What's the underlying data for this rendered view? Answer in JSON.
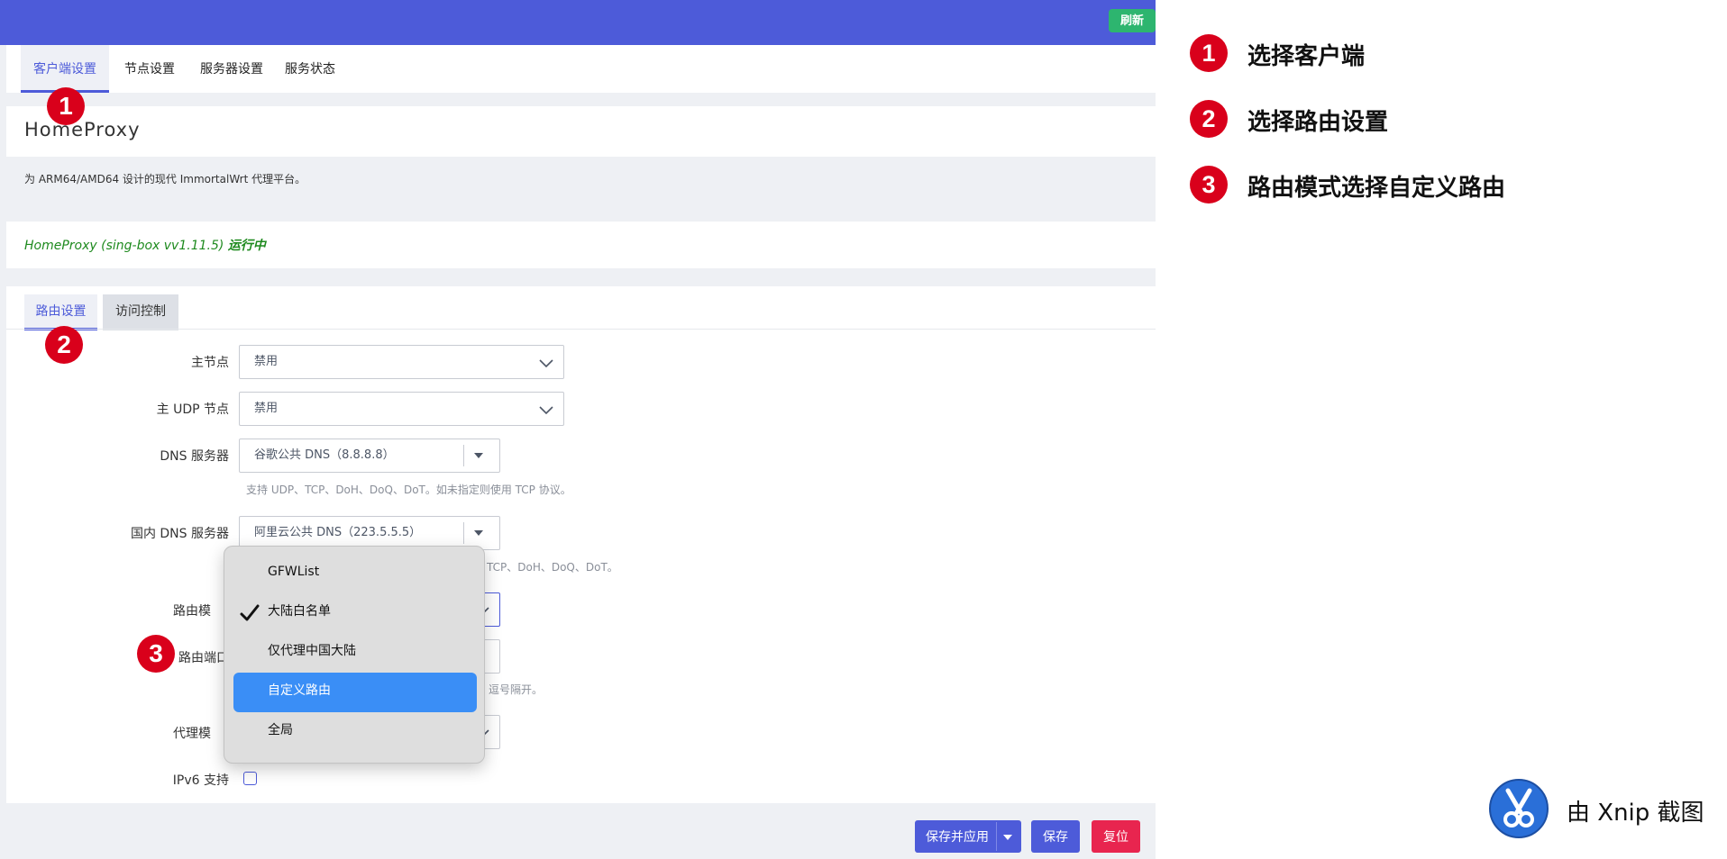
{
  "header": {
    "refresh_label": "刷新"
  },
  "main_tabs": [
    {
      "label": "客户端设置",
      "active": true
    },
    {
      "label": "节点设置",
      "active": false
    },
    {
      "label": "服务器设置",
      "active": false
    },
    {
      "label": "服务状态",
      "active": false
    }
  ],
  "page": {
    "title": "HomeProxy",
    "description": "为 ARM64/AMD64 设计的现代 ImmortalWrt 代理平台。",
    "status_prefix": "HomeProxy (sing-box vv1.11.5) ",
    "status_state": "运行中"
  },
  "sub_tabs": [
    {
      "label": "路由设置",
      "active": true
    },
    {
      "label": "访问控制",
      "active": false
    }
  ],
  "fields": {
    "main_node": {
      "label": "主节点",
      "value": "禁用"
    },
    "main_udp_node": {
      "label": "主 UDP 节点",
      "value": "禁用"
    },
    "dns_server": {
      "label": "DNS 服务器",
      "value": "谷歌公共 DNS（8.8.8.8）",
      "hint": "支持 UDP、TCP、DoH、DoQ、DoT。如未指定则使用 TCP 协议。"
    },
    "china_dns_server": {
      "label": "国内 DNS 服务器",
      "value": "阿里云公共 DNS（223.5.5.5）",
      "hint_visible": "TCP、DoH、DoQ、DoT。"
    },
    "routing_mode": {
      "label_visible": "路由模"
    },
    "routing_port": {
      "label_visible": "路由端口",
      "hint_visible": "逗号隔开。"
    },
    "proxy_mode": {
      "label_visible": "代理模"
    },
    "ipv6": {
      "label": "IPv6 支持",
      "checked": false
    }
  },
  "routing_mode_dropdown": {
    "options": [
      "GFWList",
      "大陆白名单",
      "仅代理中国大陆",
      "自定义路由",
      "全局"
    ],
    "checked": "大陆白名单",
    "highlighted": "自定义路由"
  },
  "actions": {
    "save_apply": "保存并应用",
    "save": "保存",
    "reset": "复位"
  },
  "annotations": {
    "markers": [
      "1",
      "2",
      "3"
    ],
    "legend": [
      {
        "num": "1",
        "text": "选择客户端"
      },
      {
        "num": "2",
        "text": "选择路由设置"
      },
      {
        "num": "3",
        "text": "路由模式选择自定义路由"
      }
    ],
    "watermark": "由 Xnip 截图"
  },
  "colors": {
    "primary": "#4d5bd9",
    "success": "#2db56f",
    "danger": "#e8254f",
    "marker": "#d9001b",
    "highlight": "#3a8ef6",
    "status": "#1e8a1e"
  }
}
